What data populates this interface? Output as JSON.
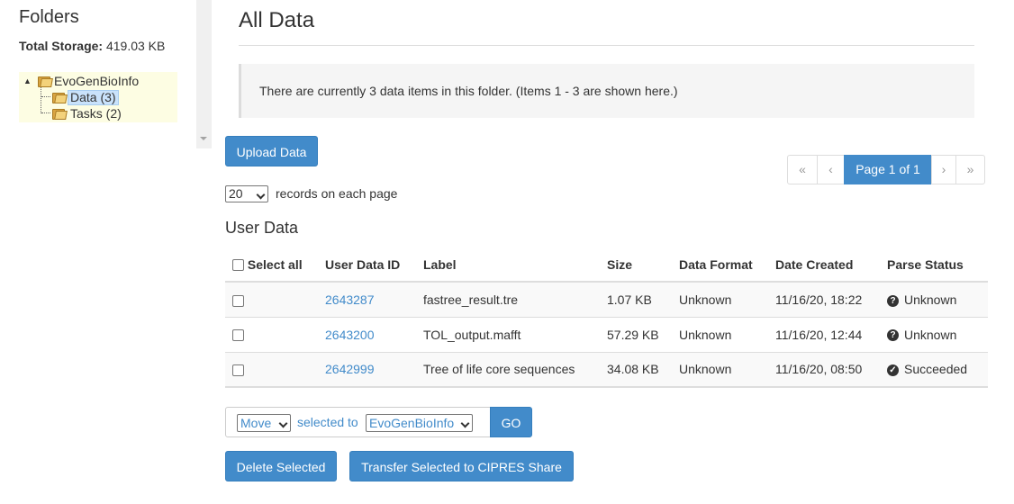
{
  "sidebar": {
    "title": "Folders",
    "storage_label": "Total Storage:",
    "storage_value": "419.03 KB",
    "tree": {
      "root": "EvoGenBioInfo",
      "children": [
        {
          "label": "Data (3)",
          "selected": true
        },
        {
          "label": "Tasks (2)",
          "selected": false
        }
      ]
    }
  },
  "main": {
    "title": "All Data",
    "info": "There are currently 3 data items in this folder. (Items 1 - 3 are shown here.)",
    "upload_label": "Upload Data",
    "pager": {
      "first": "«",
      "prev": "‹",
      "current": "Page 1 of 1",
      "next": "›",
      "last": "»"
    },
    "per_page": {
      "value": "20",
      "label": "records on each page"
    },
    "section_title": "User Data",
    "table": {
      "headers": {
        "select_all": "Select all",
        "id": "User Data ID",
        "label": "Label",
        "size": "Size",
        "format": "Data Format",
        "date": "Date Created",
        "status": "Parse Status"
      },
      "rows": [
        {
          "id": "2643287",
          "label": "fastree_result.tre",
          "size": "1.07 KB",
          "format": "Unknown",
          "date": "11/16/20, 18:22",
          "status": "Unknown",
          "status_icon": "question-circle-icon",
          "status_glyph": "?"
        },
        {
          "id": "2643200",
          "label": "TOL_output.mafft",
          "size": "57.29 KB",
          "format": "Unknown",
          "date": "11/16/20, 12:44",
          "status": "Unknown",
          "status_icon": "question-circle-icon",
          "status_glyph": "?"
        },
        {
          "id": "2642999",
          "label": "Tree of life core sequences",
          "size": "34.08 KB",
          "format": "Unknown",
          "date": "11/16/20, 08:50",
          "status": "Succeeded",
          "status_icon": "check-circle-icon",
          "status_glyph": "✓"
        }
      ]
    },
    "actions": {
      "move_value": "Move",
      "selected_to": "selected to",
      "destination": "EvoGenBioInfo",
      "go_label": "GO",
      "delete_label": "Delete Selected",
      "transfer_label": "Transfer Selected to CIPRES Share"
    }
  },
  "colors": {
    "accent": "#428bca",
    "tree_bg": "#fdfde3",
    "info_bg": "#f5f5f5"
  }
}
